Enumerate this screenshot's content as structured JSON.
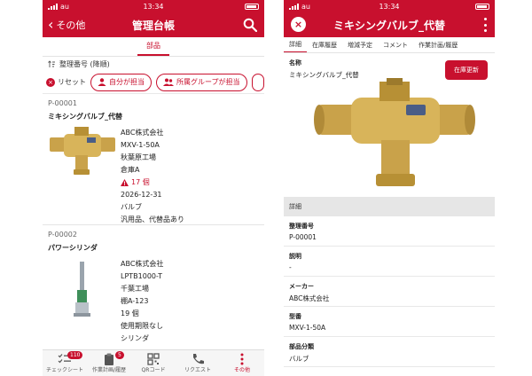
{
  "status": {
    "carrier": "au",
    "time": "13:34"
  },
  "left": {
    "nav": {
      "back_label": "その他",
      "title": "管理台帳"
    },
    "segment_tab": "部品",
    "sort_label": "整理番号 (降順)",
    "reset_label": "リセット",
    "chips": [
      "自分が担当",
      "所属グループが担当"
    ],
    "items": [
      {
        "id": "P-00001",
        "name": "ミキシングバルブ_代替",
        "maker": "ABC株式会社",
        "model": "MXV-1-50A",
        "location": "秋葉原工場",
        "storage": "倉庫A",
        "quantity": "17 個",
        "expiry": "2026-12-31",
        "category": "バルブ",
        "note": "汎用品、代替品あり"
      },
      {
        "id": "P-00002",
        "name": "パワーシリンダ",
        "maker": "ABC株式会社",
        "model": "LPTB1000-T",
        "location": "千葉工場",
        "storage": "棚A-123",
        "quantity": "19 個",
        "expiry": "使用期限なし",
        "category": "シリンダ"
      }
    ],
    "tabs": [
      {
        "label": "チェックシート",
        "badge": "110"
      },
      {
        "label": "作業計画/履歴",
        "badge": "5"
      },
      {
        "label": "QRコード"
      },
      {
        "label": "リクエスト"
      },
      {
        "label": "その他"
      }
    ]
  },
  "right": {
    "nav": {
      "title": "ミキシングバルブ_代替"
    },
    "tabs": [
      "詳細",
      "在庫履歴",
      "増減予定",
      "コメント",
      "作業計画/履歴"
    ],
    "name_label": "名称",
    "name_value": "ミキシングバルブ_代替",
    "stock_update_button": "在庫更新",
    "section_title": "詳細",
    "fields": [
      {
        "label": "整理番号",
        "value": "P-00001"
      },
      {
        "label": "説明",
        "value": "-"
      },
      {
        "label": "メーカー",
        "value": "ABC株式会社"
      },
      {
        "label": "型番",
        "value": "MXV-1-50A"
      },
      {
        "label": "部品分類",
        "value": "バルブ"
      }
    ]
  },
  "colors": {
    "accent": "#c8102e",
    "section_bg": "#e6e6e6"
  }
}
